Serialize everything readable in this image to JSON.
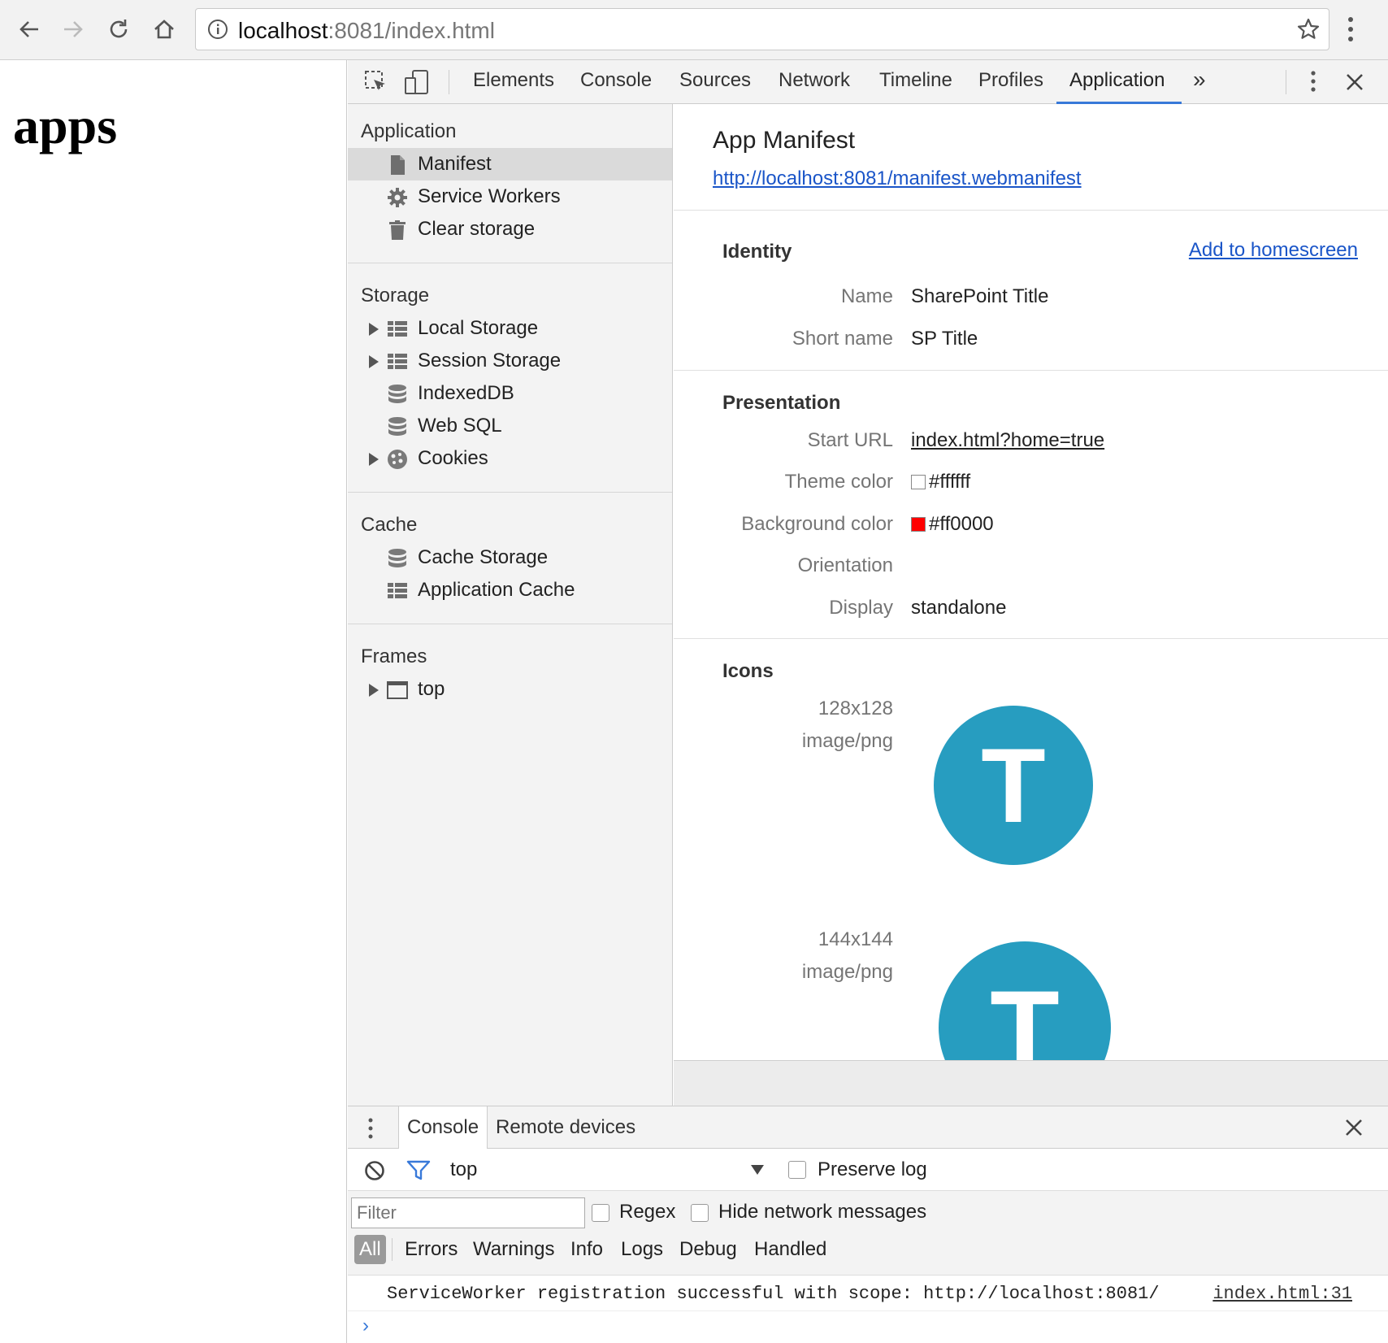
{
  "browser": {
    "url_host": "localhost",
    "url_rest": ":8081/index.html",
    "icons": [
      "back-arrow-icon",
      "forward-arrow-icon",
      "reload-icon",
      "home-icon",
      "info-icon",
      "star-icon",
      "kebab-menu-icon"
    ]
  },
  "page": {
    "heading": "apps"
  },
  "devtools": {
    "tabs": [
      "Elements",
      "Console",
      "Sources",
      "Network",
      "Timeline",
      "Profiles",
      "Application"
    ],
    "active_tab": "Application",
    "more_tabs": "»",
    "sidebar": {
      "sections": {
        "application": {
          "title": "Application",
          "items": [
            "Manifest",
            "Service Workers",
            "Clear storage"
          ]
        },
        "storage": {
          "title": "Storage",
          "items": [
            "Local Storage",
            "Session Storage",
            "IndexedDB",
            "Web SQL",
            "Cookies"
          ]
        },
        "cache": {
          "title": "Cache",
          "items": [
            "Cache Storage",
            "Application Cache"
          ]
        },
        "frames": {
          "title": "Frames",
          "items": [
            "top"
          ]
        }
      },
      "selected": "Manifest"
    },
    "manifest": {
      "title": "App Manifest",
      "url": "http://localhost:8081/manifest.webmanifest",
      "identity": {
        "title": "Identity",
        "action": "Add to homescreen",
        "name_label": "Name",
        "name": "SharePoint Title",
        "short_name_label": "Short name",
        "short_name": "SP Title"
      },
      "presentation": {
        "title": "Presentation",
        "start_url_label": "Start URL",
        "start_url": "index.html?home=true",
        "theme_color_label": "Theme color",
        "theme_color": "#ffffff",
        "background_color_label": "Background color",
        "background_color": "#ff0000",
        "orientation_label": "Orientation",
        "orientation": "",
        "display_label": "Display",
        "display": "standalone"
      },
      "icons": {
        "title": "Icons",
        "items": [
          {
            "size": "128x128",
            "type": "image/png",
            "letter": "T"
          },
          {
            "size": "144x144",
            "type": "image/png",
            "letter": "T"
          }
        ],
        "icon_color": "#279dc0"
      }
    },
    "drawer": {
      "tabs": [
        "Console",
        "Remote devices"
      ],
      "context": "top",
      "preserve_log": "Preserve log",
      "filter_placeholder": "Filter",
      "regex": "Regex",
      "hide_network": "Hide network messages",
      "levels": [
        "All",
        "Errors",
        "Warnings",
        "Info",
        "Logs",
        "Debug",
        "Handled"
      ],
      "message": "ServiceWorker registration successful with scope: http://localhost:8081/",
      "message_source": "index.html:31",
      "prompt": "›"
    },
    "accent": "#3879d9"
  }
}
